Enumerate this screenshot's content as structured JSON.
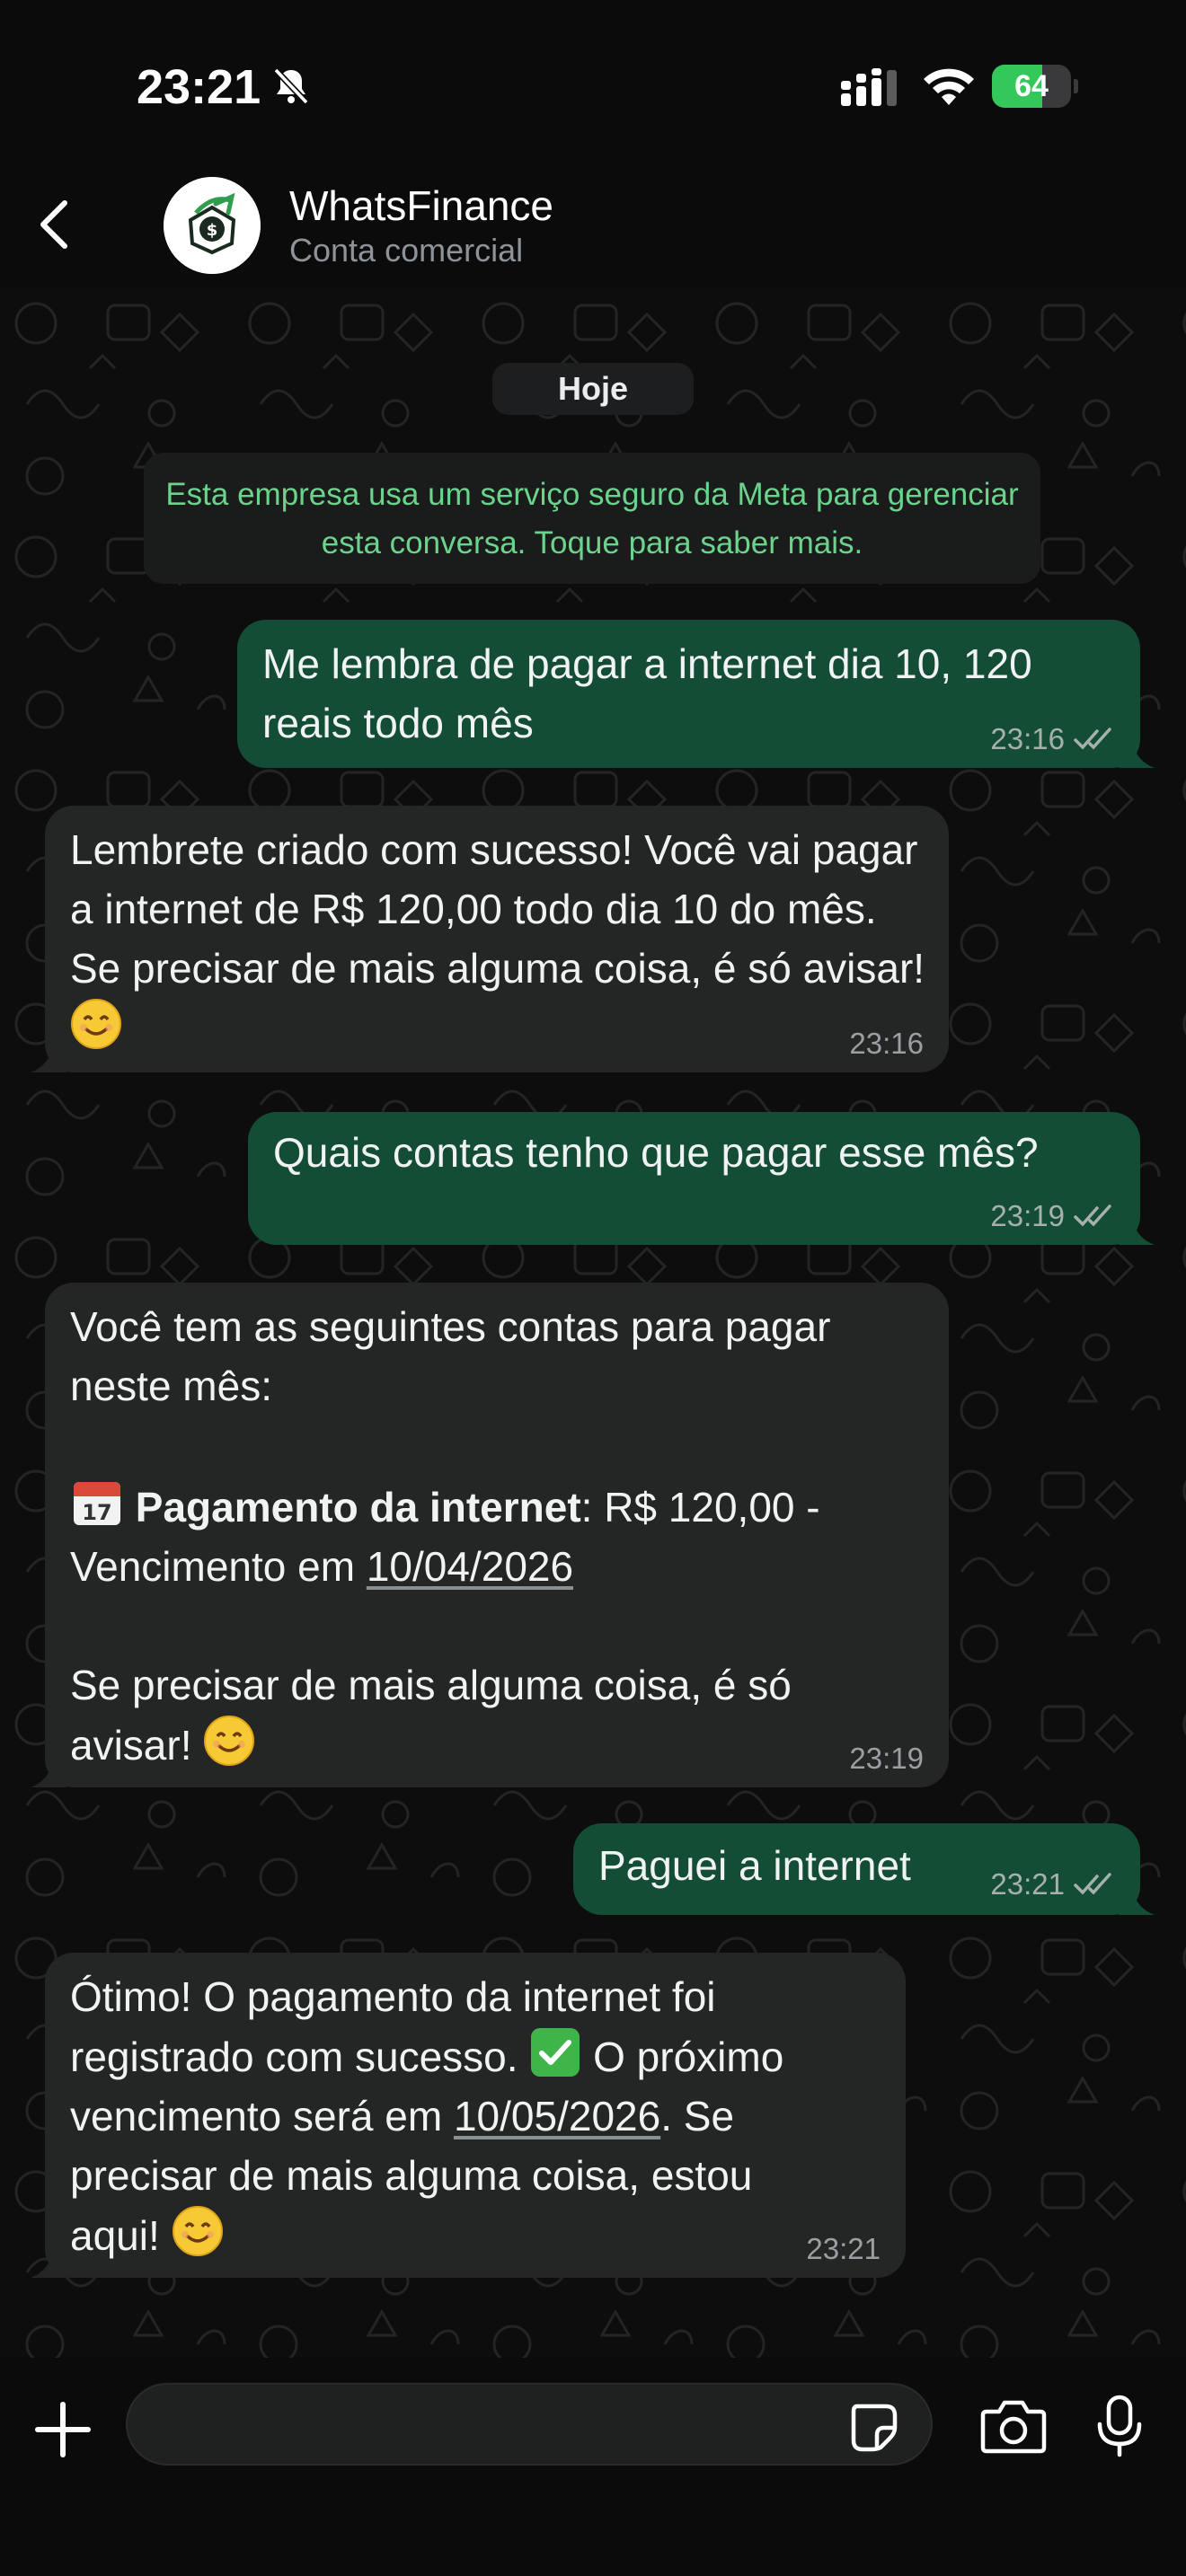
{
  "status_bar": {
    "time": "23:21",
    "battery_level": "64",
    "battery_fraction": 0.64,
    "icons": [
      "bell-slash-icon",
      "signal-icon",
      "wifi-icon",
      "battery-icon"
    ]
  },
  "header": {
    "contact_name": "WhatsFinance",
    "contact_subtitle": "Conta comercial",
    "icons": [
      "back-chevron-icon",
      "avatar-money-logo"
    ]
  },
  "chat": {
    "date_chip": "Hoje",
    "system_notice": "Esta empresa usa um serviço seguro da Meta para gerenciar esta conversa. Toque para saber mais.",
    "messages": [
      {
        "direction": "out",
        "text": "Me lembra de pagar a internet dia 10, 120 reais todo mês",
        "time": "23:16",
        "status": "read"
      },
      {
        "direction": "in",
        "text": "Lembrete criado com sucesso! Você vai pagar a internet de R$ 120,00 todo dia 10 do mês. Se precisar de mais alguma coisa, é só avisar!",
        "time": "23:16"
      },
      {
        "direction": "out",
        "text": "Quais contas tenho que pagar esse mês?",
        "time": "23:19",
        "status": "read"
      },
      {
        "direction": "in",
        "intro": "Você tem as seguintes contas para pagar neste mês:",
        "item_bold": "Pagamento da internet",
        "item_rest": ": R$ 120,00 -",
        "item_due_prefix": "Vencimento em ",
        "item_due_date": "10/04/2026",
        "outro_line1": "Se precisar de mais alguma coisa, é só",
        "outro_line2": "avisar!",
        "time": "23:19"
      },
      {
        "direction": "out",
        "text": "Paguei a internet",
        "time": "23:21",
        "status": "read"
      },
      {
        "direction": "in",
        "line1": "Ótimo! O pagamento da internet foi",
        "line2a": "registrado com sucesso.",
        "line2b": "O próximo",
        "line3a": "vencimento será em ",
        "line3_date": "10/05/2026",
        "line3b": ". Se",
        "line4": "precisar de mais alguma coisa, estou",
        "line5": "aqui!",
        "time": "23:21"
      }
    ]
  },
  "input_bar": {
    "placeholder": "",
    "icons": [
      "plus-icon",
      "sticker-icon",
      "camera-icon",
      "microphone-icon"
    ]
  },
  "colors": {
    "outgoing_bubble": "#134d36",
    "incoming_bubble": "#242626",
    "notice_text": "#6bd38c",
    "battery_fill": "#34c759",
    "read_ticks": "#a8b0ad"
  }
}
